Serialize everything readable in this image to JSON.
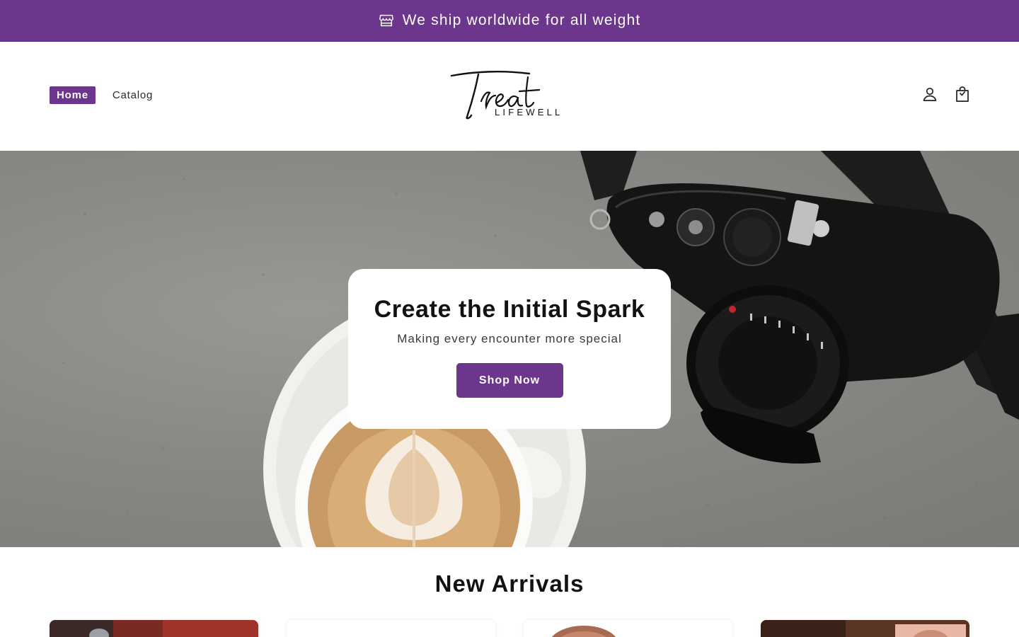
{
  "announcement": {
    "text": "We ship worldwide for all weight",
    "icon": "store-icon",
    "background": "#6b368c"
  },
  "header": {
    "nav": [
      {
        "label": "Home",
        "active": true
      },
      {
        "label": "Catalog",
        "active": false
      }
    ],
    "logo": {
      "script": "Treat",
      "sub": "LIFEWELL"
    },
    "icons": [
      "account-icon",
      "cart-icon"
    ]
  },
  "hero": {
    "title": "Create the Initial Spark",
    "subtitle": "Making every encounter more special",
    "button_label": "Shop Now"
  },
  "new_arrivals": {
    "title": "New Arrivals",
    "cards": [
      {
        "name": "product-card-1"
      },
      {
        "name": "product-card-2"
      },
      {
        "name": "product-card-3"
      },
      {
        "name": "product-card-4"
      }
    ]
  },
  "colors": {
    "accent": "#6b368c",
    "text": "#121212",
    "background": "#ffffff"
  }
}
